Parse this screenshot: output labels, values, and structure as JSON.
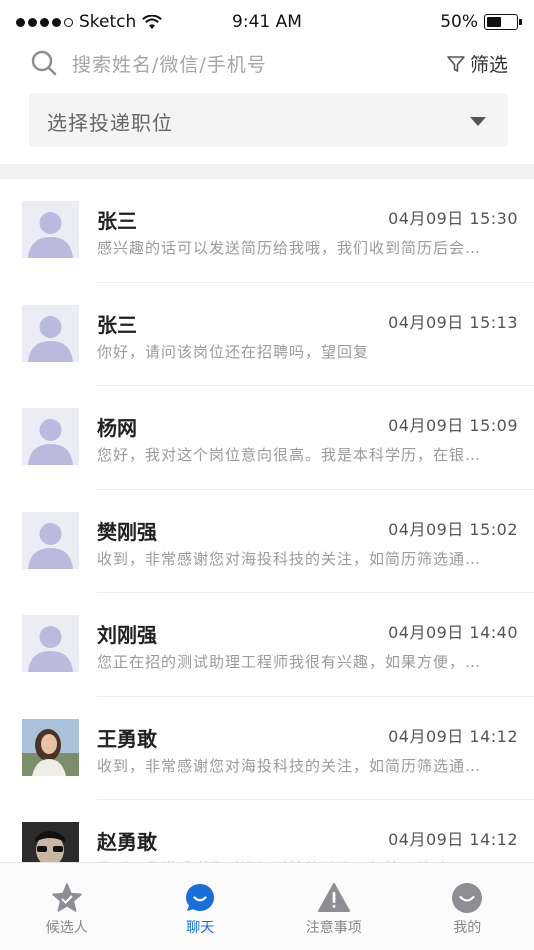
{
  "status_bar": {
    "carrier": "Sketch",
    "time": "9:41 AM",
    "battery": "50%"
  },
  "search": {
    "placeholder": "搜索姓名/微信/手机号",
    "filter_label": "筛选"
  },
  "position_select": {
    "placeholder": "选择投递职位"
  },
  "conversations": [
    {
      "name": "张三",
      "time": "04月09日 15:30",
      "message": "感兴趣的话可以发送简历给我哦，我们收到简历后会…",
      "avatar": "placeholder"
    },
    {
      "name": "张三",
      "time": "04月09日 15:13",
      "message": "你好，请问该岗位还在招聘吗，望回复",
      "avatar": "placeholder"
    },
    {
      "name": "杨网",
      "time": "04月09日 15:09",
      "message": "您好，我对这个岗位意向很高。我是本科学历，在银…",
      "avatar": "placeholder"
    },
    {
      "name": "樊刚强",
      "time": "04月09日 15:02",
      "message": "收到，非常感谢您对海投科技的关注，如简历筛选通…",
      "avatar": "placeholder"
    },
    {
      "name": "刘刚强",
      "time": "04月09日 14:40",
      "message": "您正在招的测试助理工程师我很有兴趣，如果方便，…",
      "avatar": "placeholder"
    },
    {
      "name": "王勇敢",
      "time": "04月09日 14:12",
      "message": "收到，非常感谢您对海投科技的关注，如简历筛选通…",
      "avatar": "photo-woman"
    },
    {
      "name": "赵勇敢",
      "time": "04月09日 14:12",
      "message": "收到，非常感谢您对海投科技的关注，如简历筛选通…",
      "avatar": "photo-man"
    }
  ],
  "tabbar": {
    "tabs": [
      {
        "label": "候选人",
        "icon": "star-icon",
        "active": false
      },
      {
        "label": "聊天",
        "icon": "chat-icon",
        "active": true
      },
      {
        "label": "注意事项",
        "icon": "warning-icon",
        "active": false
      },
      {
        "label": "我的",
        "icon": "profile-icon",
        "active": false
      }
    ]
  },
  "colors": {
    "accent": "#1a6fd6",
    "avatar_placeholder": "#b9bade",
    "muted_text": "#9a9a9f",
    "icon_gray": "#8d8d93"
  }
}
